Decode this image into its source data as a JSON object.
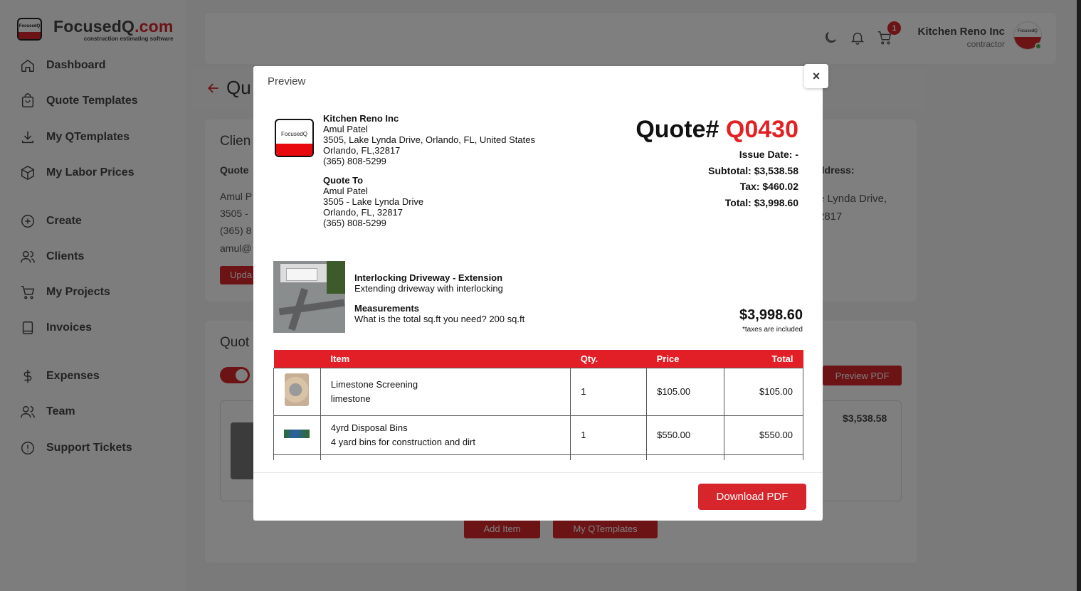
{
  "brand": {
    "logo_text": "FocusedQ",
    "name_part1": "FocusedQ",
    "name_part2": ".com",
    "tagline": "construction estimating software",
    "accent_color": "#d7262b"
  },
  "sidebar": {
    "items": [
      {
        "label": "Dashboard",
        "icon": "home-icon"
      },
      {
        "label": "Quote Templates",
        "icon": "bag-icon"
      },
      {
        "label": "My QTemplates",
        "icon": "download-icon"
      },
      {
        "label": "My Labor Prices",
        "icon": "cube-icon"
      },
      {
        "label": "Create",
        "icon": "plus-circle-icon"
      },
      {
        "label": "Clients",
        "icon": "users-icon"
      },
      {
        "label": "My Projects",
        "icon": "cart-icon"
      },
      {
        "label": "Invoices",
        "icon": "book-icon"
      },
      {
        "label": "Expenses",
        "icon": "dollar-icon"
      },
      {
        "label": "Team",
        "icon": "team-icon"
      },
      {
        "label": "Support Tickets",
        "icon": "alert-circle-icon"
      }
    ]
  },
  "topbar": {
    "cart_count": "1",
    "user_name": "Kitchen Reno Inc",
    "user_role": "contractor",
    "avatar_text": "FocusedQ"
  },
  "background": {
    "page_title": "Qu",
    "client_card_title": "Clien",
    "client_sub": "Quote",
    "client_lines": [
      "Amul P",
      "3505 -",
      "(365) 8",
      "amul@"
    ],
    "update_btn": "Upda",
    "address_label": "ddress:",
    "address_line1": "e Lynda Drive,",
    "address_line2": "2817",
    "quote_card_title": "Quot",
    "preview_pdf_btn": "Preview PDF",
    "item_price": "$3,538.58",
    "add_item_btn": "Add Item",
    "my_qtemplates_btn": "My QTemplates"
  },
  "modal": {
    "title": "Preview",
    "close_label": "×",
    "logo_text": "FocusedQ",
    "from": {
      "company": "Kitchen Reno Inc",
      "contact": "Amul Patel",
      "address": "3505, Lake Lynda Drive, Orlando, FL, United States",
      "city": "Orlando, FL,32817",
      "phone": "(365) 808-5299"
    },
    "to": {
      "heading": "Quote To",
      "name": "Amul Patel",
      "address": "3505 - Lake Lynda Drive",
      "city": "Orlando, FL, 32817",
      "phone": "(365) 808-5299"
    },
    "quote_label": "Quote#",
    "quote_id": "Q0430",
    "issue_date": "Issue Date: -",
    "subtotal": "Subtotal: $3,538.58",
    "tax": "Tax: $460.02",
    "total": "Total: $3,998.60",
    "product": {
      "title": "Interlocking Driveway - Extension",
      "description": "Extending driveway with interlocking",
      "measure_heading": "Measurements",
      "measure_question": "What is the total sq.ft you need? 200 sq.ft",
      "total": "$3,998.60",
      "note": "*taxes are included"
    },
    "table": {
      "headers": [
        "",
        "Item",
        "Qty.",
        "Price",
        "Total"
      ],
      "rows": [
        {
          "name": "Limestone Screening",
          "desc": "limestone",
          "qty": "1",
          "price": "$105.00",
          "total": "$105.00",
          "thumb": "limestone-thumb"
        },
        {
          "name": "4yrd Disposal Bins",
          "desc": "4 yard bins for construction and dirt",
          "qty": "1",
          "price": "$550.00",
          "total": "$550.00",
          "thumb": "bin-thumb"
        }
      ]
    },
    "download_btn": "Download PDF"
  }
}
